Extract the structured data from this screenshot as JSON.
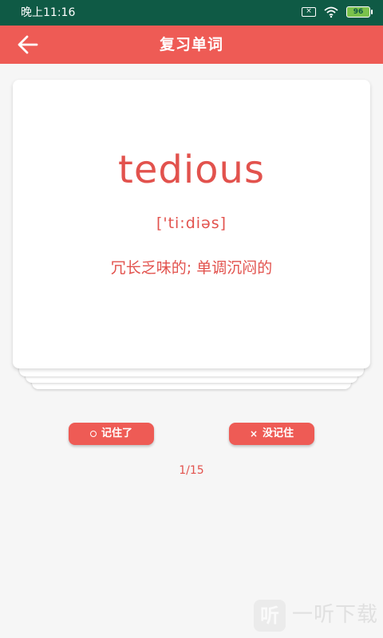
{
  "status_bar": {
    "time": "晚上11:16",
    "sim_icon": "sim-x-icon",
    "wifi_icon": "wifi-icon",
    "battery_level": "96"
  },
  "toolbar": {
    "back_icon": "arrow-left-icon",
    "title": "复习单词"
  },
  "card": {
    "word": "tedious",
    "phonetic": "['ti:diəs]",
    "meaning": "冗长乏味的; 单调沉闷的"
  },
  "actions": {
    "remember_label": "记住了",
    "remember_icon": "circle-icon",
    "forget_label": "没记住",
    "forget_icon": "cross-icon"
  },
  "progress": {
    "text": "1/15"
  },
  "watermark": {
    "logo_char": "听",
    "text": "一听下载"
  },
  "colors": {
    "status_bar": "#0f5a45",
    "accent": "#ee5b55",
    "text_accent": "#e2524d",
    "background": "#f6f6f6"
  }
}
